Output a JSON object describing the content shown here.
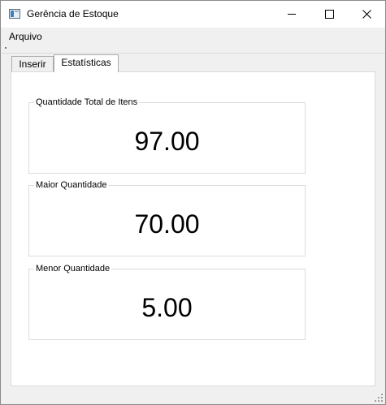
{
  "window": {
    "title": "Gerência de Estoque",
    "icon": "app-window-icon"
  },
  "menu": {
    "items": [
      "Arquivo"
    ]
  },
  "tabs": [
    {
      "label": "Inserir",
      "active": false
    },
    {
      "label": "Estatísticas",
      "active": true
    }
  ],
  "stats": [
    {
      "label": "Quantidade Total de Itens",
      "value": "97.00"
    },
    {
      "label": "Maior Quantidade",
      "value": "70.00"
    },
    {
      "label": "Menor Quantidade",
      "value": "5.00"
    }
  ]
}
